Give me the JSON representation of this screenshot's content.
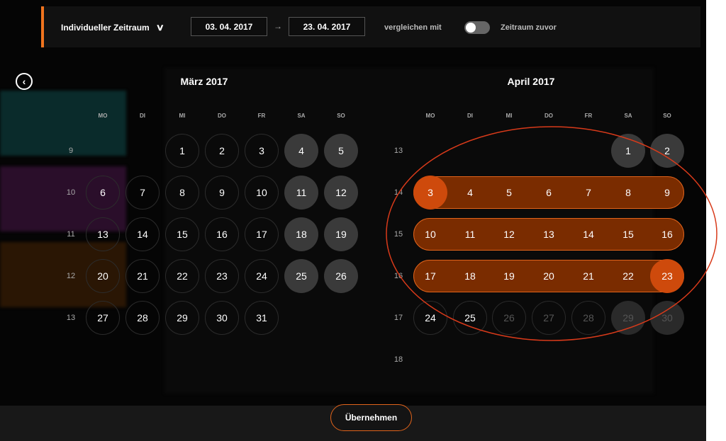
{
  "header": {
    "range_label": "Individueller Zeitraum",
    "start_date": "03. 04. 2017",
    "arrow": "→",
    "end_date": "23. 04. 2017",
    "compare_label": "vergleichen mit",
    "compare_value": "Zeitraum zuvor"
  },
  "calendars": [
    {
      "title": "März 2017",
      "weekdays": [
        "MO",
        "DI",
        "MI",
        "DO",
        "FR",
        "SA",
        "SO"
      ],
      "weeks": [
        {
          "wk": "9",
          "days": [
            null,
            null,
            "1",
            "2",
            "3",
            "4",
            "5"
          ]
        },
        {
          "wk": "10",
          "days": [
            "6",
            "7",
            "8",
            "9",
            "10",
            "11",
            "12"
          ]
        },
        {
          "wk": "11",
          "days": [
            "13",
            "14",
            "15",
            "16",
            "17",
            "18",
            "19"
          ]
        },
        {
          "wk": "12",
          "days": [
            "20",
            "21",
            "22",
            "23",
            "24",
            "25",
            "26"
          ]
        },
        {
          "wk": "13",
          "days": [
            "27",
            "28",
            "29",
            "30",
            "31",
            null,
            null
          ]
        }
      ]
    },
    {
      "title": "April 2017",
      "weekdays": [
        "MO",
        "DI",
        "MI",
        "DO",
        "FR",
        "SA",
        "SO"
      ],
      "weeks": [
        {
          "wk": "13",
          "days": [
            null,
            null,
            null,
            null,
            null,
            "1",
            "2"
          ]
        },
        {
          "wk": "14",
          "days": [
            "3",
            "4",
            "5",
            "6",
            "7",
            "8",
            "9"
          ]
        },
        {
          "wk": "15",
          "days": [
            "10",
            "11",
            "12",
            "13",
            "14",
            "15",
            "16"
          ]
        },
        {
          "wk": "16",
          "days": [
            "17",
            "18",
            "19",
            "20",
            "21",
            "22",
            "23"
          ]
        },
        {
          "wk": "17",
          "days": [
            "24",
            "25",
            "26",
            "27",
            "28",
            "29",
            "30"
          ]
        },
        {
          "wk": "18",
          "days": [
            null,
            null,
            null,
            null,
            null,
            null,
            null
          ]
        }
      ],
      "selected_start": "3",
      "selected_end": "23",
      "disabled_from": "26"
    }
  ],
  "colors": {
    "accent": "#e0631b",
    "selection_fill": "#7a2c00",
    "endpoint": "#ce4a0c",
    "annotation": "#d83a1a"
  },
  "footer": {
    "apply_label": "Übernehmen"
  }
}
